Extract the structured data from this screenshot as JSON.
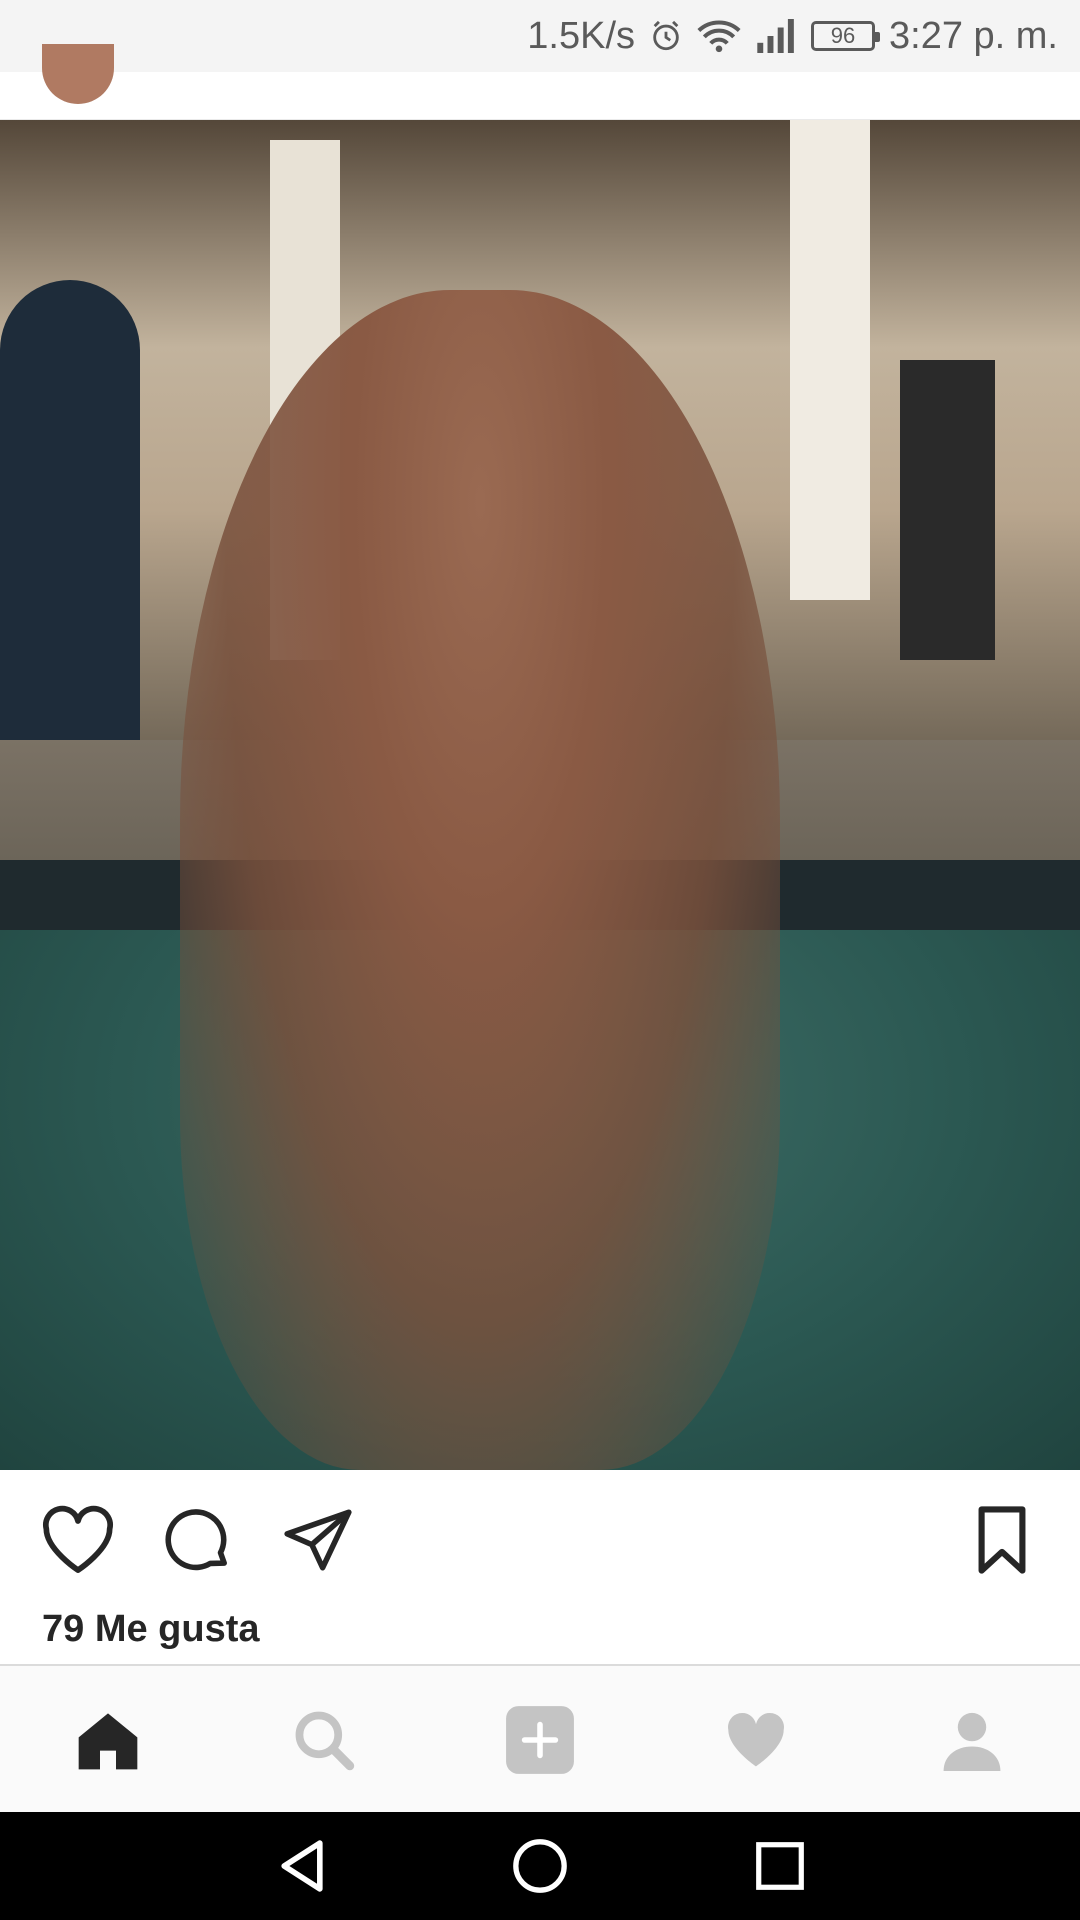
{
  "status_bar": {
    "net_speed": "1.5K/s",
    "battery": "96",
    "time": "3:27 p. m.",
    "icons": [
      "alarm-icon",
      "wifi-icon",
      "signal-icon",
      "battery-icon"
    ]
  },
  "post": {
    "likes_text": "79 Me gusta",
    "actions": [
      "like-heart-icon",
      "comment-icon",
      "share-icon",
      "bookmark-icon"
    ]
  },
  "bottom_nav": {
    "items": [
      "home-icon",
      "search-icon",
      "add-post-icon",
      "activity-heart-icon",
      "profile-icon"
    ],
    "active": "home-icon"
  },
  "android_nav": [
    "back-icon",
    "home-circle-icon",
    "recents-icon"
  ],
  "colors": {
    "text": "#262626",
    "icon_inactive": "#c4c4c4",
    "icon_active": "#262626"
  }
}
